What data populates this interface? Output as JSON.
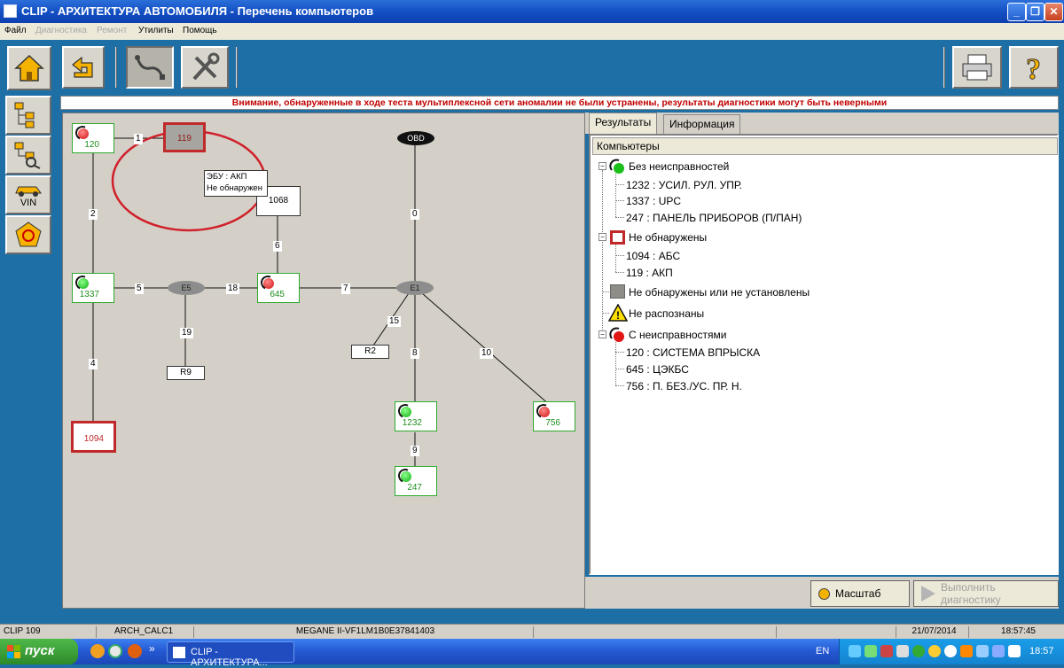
{
  "window": {
    "title": "CLIP - АРХИТЕКТУРА АВТОМОБИЛЯ - Перечень компьютеров"
  },
  "menu": [
    {
      "label": "Файл",
      "enabled": true
    },
    {
      "label": "Диагностика",
      "enabled": false
    },
    {
      "label": "Ремонт",
      "enabled": false
    },
    {
      "label": "Утилиты",
      "enabled": true
    },
    {
      "label": "Помощь",
      "enabled": true
    }
  ],
  "warning": "Внимание, обнаруженные в ходе теста мультиплексной сети аномалии не были устранены, результаты диагностики могут быть неверными",
  "left_buttons": {
    "vin_label": "VIN"
  },
  "diagram": {
    "nodes": {
      "n120": "120",
      "n119": "119",
      "n1337": "1337",
      "n1094": "1094",
      "n645": "645",
      "n1232": "1232",
      "n247": "247",
      "n756": "756",
      "n1068": "1068"
    },
    "hubs": {
      "obd": "OBD",
      "e5": "E5",
      "e1": "E1"
    },
    "resistors": {
      "r9": "R9",
      "r2": "R2"
    },
    "edges": {
      "e0": "0",
      "e1": "1",
      "e2": "2",
      "e4": "4",
      "e5": "5",
      "e6": "6",
      "e7": "7",
      "e8": "8",
      "e9": "9",
      "e10": "10",
      "e15": "15",
      "e18": "18",
      "e19": "19"
    },
    "tooltip": {
      "line1": "ЭБУ : АКП",
      "line2": "Не обнаружен"
    }
  },
  "tabs": {
    "results": "Результаты",
    "info": "Информация"
  },
  "tree": {
    "header": "Компьютеры",
    "groups": [
      {
        "label": "Без неисправностей",
        "items": [
          "1232 : УСИЛ. РУЛ. УПР.",
          "1337 : UPC",
          "247 : ПАНЕЛЬ ПРИБОРОВ (П/ПАН)"
        ]
      },
      {
        "label": "Не обнаружены",
        "items": [
          "1094 : АБС",
          "119 : АКП"
        ]
      },
      {
        "label": "Не обнаружены или не установлены",
        "items": []
      },
      {
        "label": "Не распознаны",
        "items": []
      },
      {
        "label": "С неисправностями",
        "items": [
          "120 : СИСТЕМА ВПРЫСКА",
          "645 : ЦЭКБС",
          "756 : П. БЕЗ./УС. ПР. Н."
        ]
      }
    ]
  },
  "buttons": {
    "zoom": "Масштаб",
    "run_diag": "Выполнить диагностику"
  },
  "status": {
    "c1": "CLIP 109",
    "c2": "ARCH_CALC1",
    "c3": "MEGANE II-VF1LM1B0E37841403",
    "date": "21/07/2014",
    "time": "18:57:45"
  },
  "taskbar": {
    "start": "пуск",
    "task": "CLIP - АРХИТЕКТУРА...",
    "lang": "EN",
    "clock": "18:57"
  }
}
